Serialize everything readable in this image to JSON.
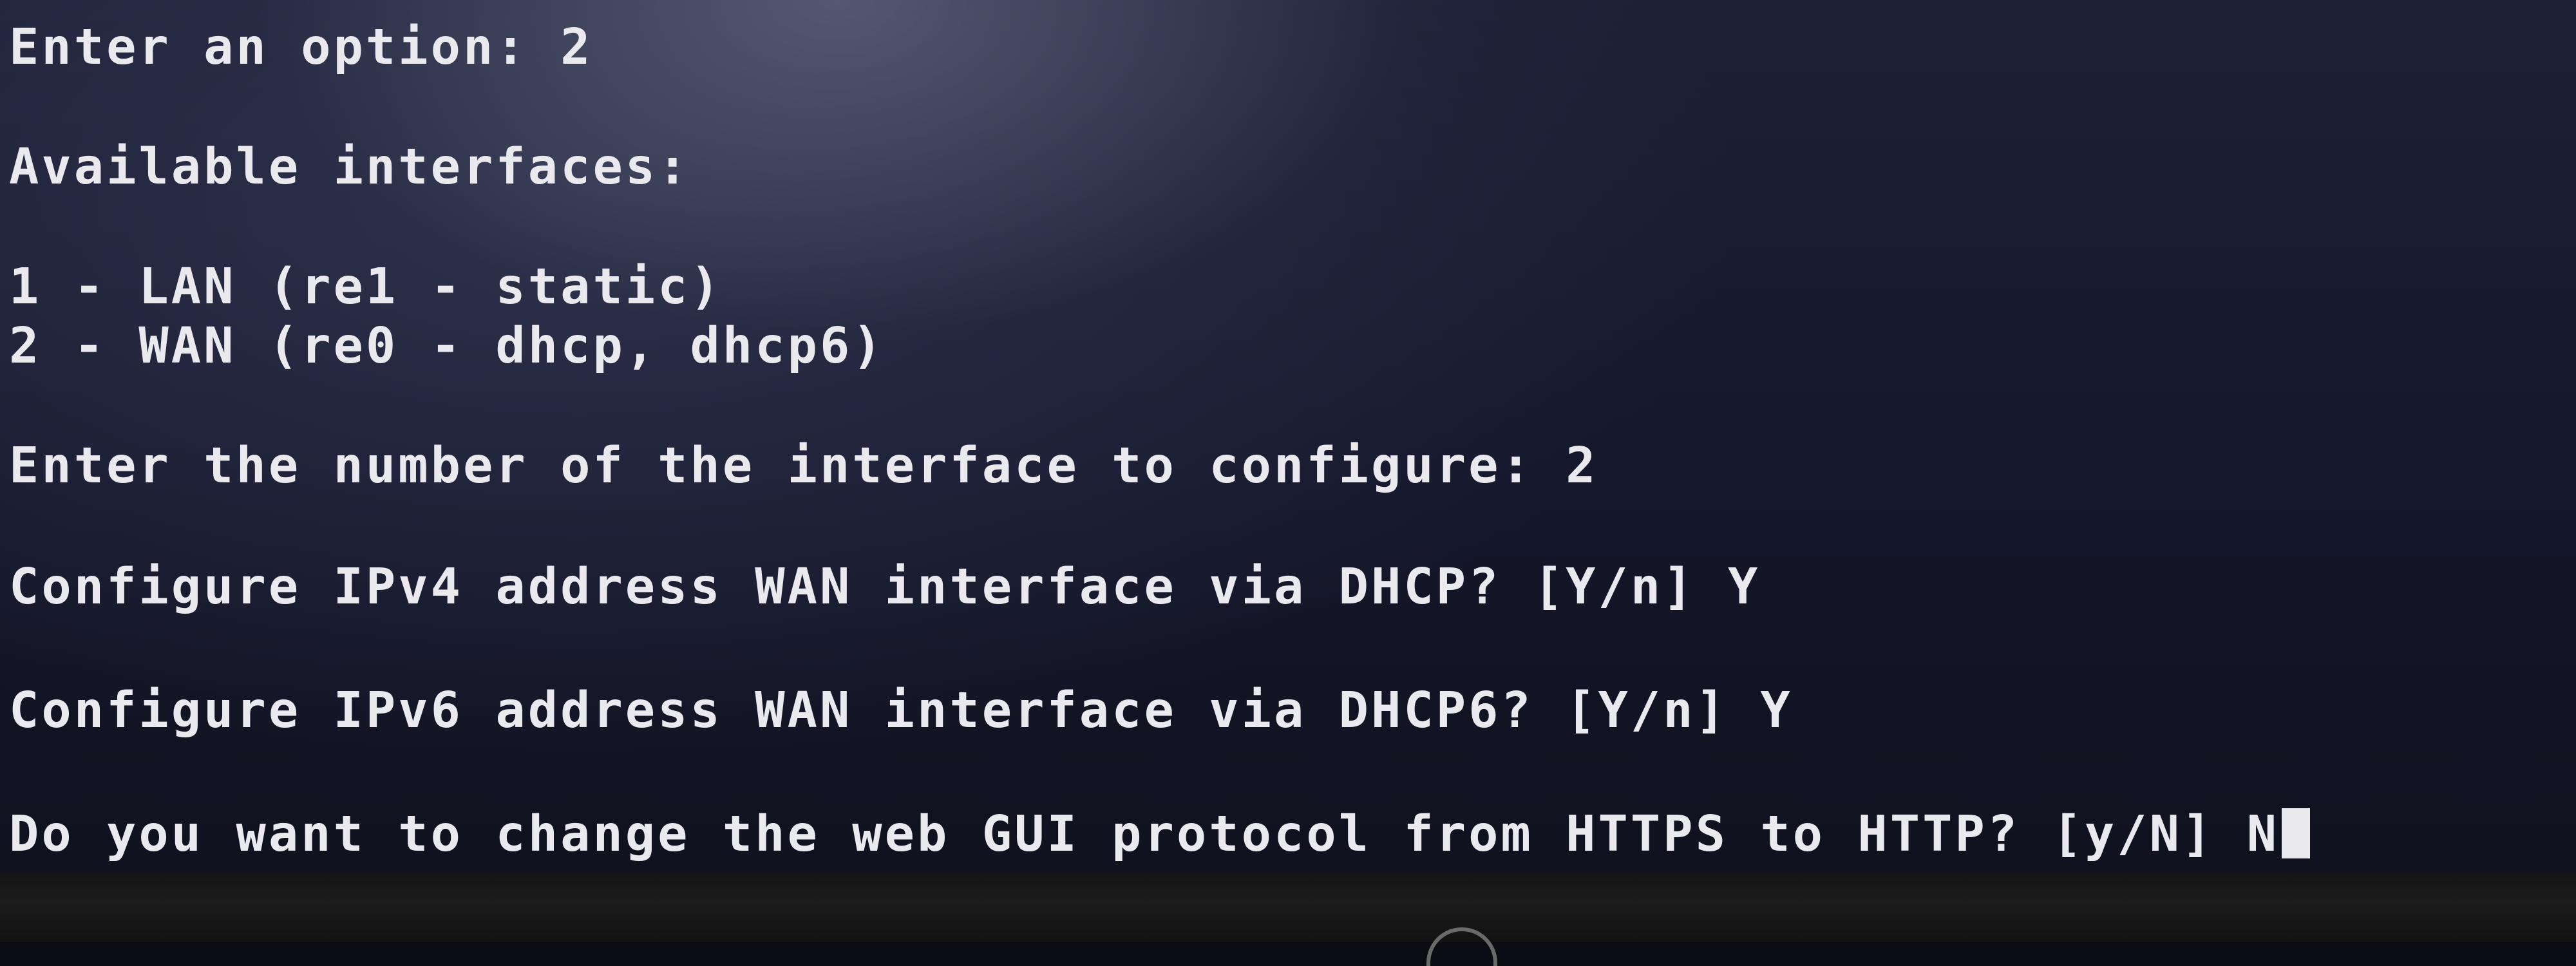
{
  "terminal": {
    "lines": [
      "Enter an option: 2",
      "Available interfaces:",
      "1 - LAN (re1 - static)",
      "2 - WAN (re0 - dhcp, dhcp6)",
      "Enter the number of the interface to configure: 2",
      "Configure IPv4 address WAN interface via DHCP? [Y/n] Y",
      "Configure IPv6 address WAN interface via DHCP6? [Y/n] Y"
    ],
    "prompt": "Do you want to change the web GUI protocol from HTTPS to HTTP? [y/N] N"
  },
  "colors": {
    "text": "#e9e9ee",
    "background": "#15172b",
    "bezel": "#1c1c1c"
  },
  "icons": {
    "monitor_logo": "hp-logo-icon",
    "cursor": "block-cursor-icon"
  }
}
